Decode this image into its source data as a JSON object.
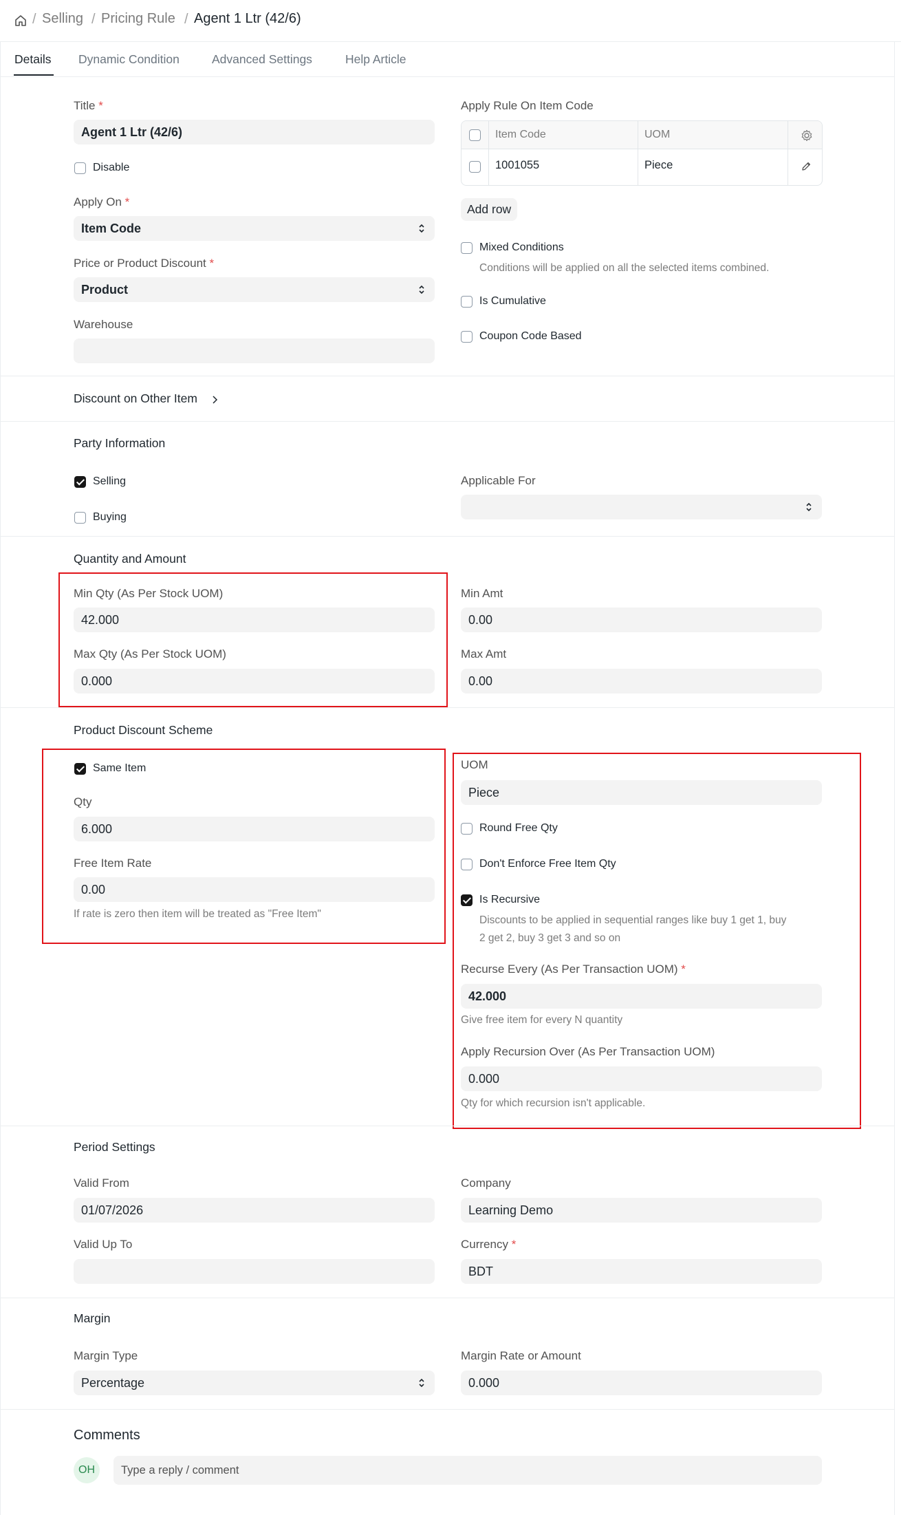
{
  "breadcrumb": {
    "items": [
      "Selling",
      "Pricing Rule"
    ],
    "current": "Agent 1 Ltr (42/6)",
    "separator": "/"
  },
  "tabs": [
    "Details",
    "Dynamic Condition",
    "Advanced Settings",
    "Help Article"
  ],
  "details": {
    "title_label": "Title",
    "title_value": "Agent 1 Ltr (42/6)",
    "disable_label": "Disable",
    "apply_on_label": "Apply On",
    "apply_on_value": "Item Code",
    "price_or_product_label": "Price or Product Discount",
    "price_or_product_value": "Product",
    "warehouse_label": "Warehouse",
    "warehouse_value": "",
    "apply_rule_label": "Apply Rule On Item Code",
    "table": {
      "col_item_code": "Item Code",
      "col_uom": "UOM",
      "rows": [
        {
          "item_code": "1001055",
          "uom": "Piece"
        }
      ]
    },
    "add_row": "Add row",
    "mixed_conditions_label": "Mixed Conditions",
    "mixed_conditions_hint": "Conditions will be applied on all the selected items combined.",
    "is_cumulative_label": "Is Cumulative",
    "coupon_code_label": "Coupon Code Based",
    "required_mark": "*"
  },
  "discount_other": {
    "label": "Discount on Other Item"
  },
  "party": {
    "title": "Party Information",
    "selling_label": "Selling",
    "buying_label": "Buying",
    "applicable_for_label": "Applicable For",
    "applicable_for_value": ""
  },
  "quantity": {
    "title": "Quantity and Amount",
    "min_qty_label": "Min Qty (As Per Stock UOM)",
    "min_qty_value": "42.000",
    "max_qty_label": "Max Qty (As Per Stock UOM)",
    "max_qty_value": "0.000",
    "min_amt_label": "Min Amt",
    "min_amt_value": "0.00",
    "max_amt_label": "Max Amt",
    "max_amt_value": "0.00"
  },
  "product_discount": {
    "title": "Product Discount Scheme",
    "same_item_label": "Same Item",
    "qty_label": "Qty",
    "qty_value": "6.000",
    "free_item_rate_label": "Free Item Rate",
    "free_item_rate_value": "0.00",
    "free_item_hint": "If rate is zero then item will be treated as \"Free Item\"",
    "uom_label": "UOM",
    "uom_value": "Piece",
    "round_free_qty_label": "Round Free Qty",
    "dont_enforce_label": "Don't Enforce Free Item Qty",
    "is_recursive_label": "Is Recursive",
    "is_recursive_hint_1": "Discounts to be applied in sequential ranges like buy 1 get 1, buy",
    "is_recursive_hint_2": "2 get 2, buy 3 get 3 and so on",
    "recurse_every_label": "Recurse Every (As Per Transaction UOM)",
    "recurse_every_value": "42.000",
    "recurse_every_hint": "Give free item for every N quantity",
    "apply_recursion_label": "Apply Recursion Over (As Per Transaction UOM)",
    "apply_recursion_value": "0.000",
    "apply_recursion_hint": "Qty for which recursion isn't applicable."
  },
  "period": {
    "title": "Period Settings",
    "valid_from_label": "Valid From",
    "valid_from_value": "01/07/2026",
    "valid_upto_label": "Valid Up To",
    "valid_upto_value": "",
    "company_label": "Company",
    "company_value": "Learning Demo",
    "currency_label": "Currency",
    "currency_value": "BDT"
  },
  "margin": {
    "title": "Margin",
    "margin_type_label": "Margin Type",
    "margin_type_value": "Percentage",
    "margin_rate_label": "Margin Rate or Amount",
    "margin_rate_value": "0.000"
  },
  "comments": {
    "title": "Comments",
    "avatar_initials": "OH",
    "placeholder": "Type a reply / comment"
  },
  "colors": {
    "highlight_box": "#e1141a",
    "required": "#e24c4c",
    "avatar_bg": "#e4f5e9",
    "avatar_fg": "#2a8a4f"
  }
}
